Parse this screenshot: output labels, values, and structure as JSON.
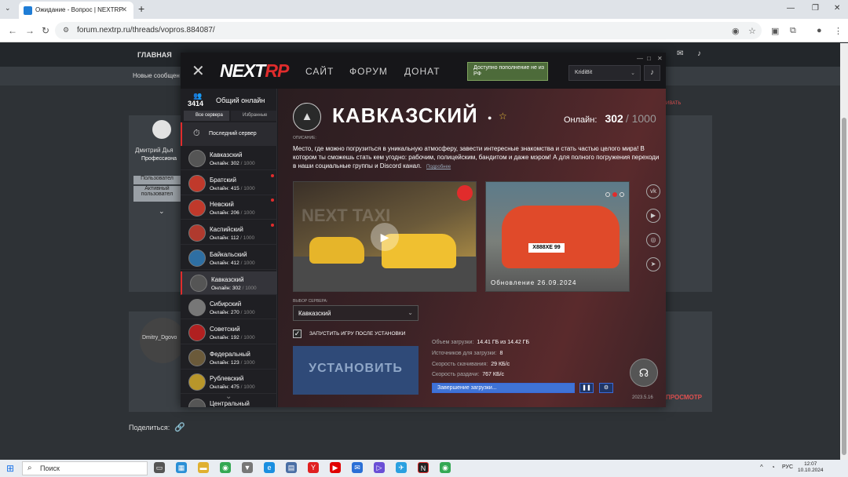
{
  "browser": {
    "tab_title": "Ожидание - Вопрос | NEXTRP",
    "url": "forum.nextrp.ru/threads/vopros.884087/"
  },
  "forum": {
    "nav_home": "ГЛАВНАЯ",
    "new_messages": "Новые сообщен",
    "user_name": "Дмитрий Дья",
    "user_role": "Профессиона",
    "btn_user": "Пользовател",
    "btn_active": "Активный пользовател",
    "reply_user": "Dmitry_Dgovo",
    "action_red": "ИВАТЬ",
    "preview": "ПРОСМОТР",
    "share_label": "Поделиться:"
  },
  "launcher": {
    "nav": [
      "САЙТ",
      "ФОРУМ",
      "ДОНАТ"
    ],
    "promo": "Доступно пополнение не из РФ",
    "username": "KridiBit",
    "online_total": "3414",
    "online_label": "Общий онлайн",
    "tab_all": "Все сервера",
    "tab_fav": "Избранные",
    "last_server": "Последний сервер",
    "online_prefix": "Онлайн:",
    "servers": [
      {
        "name": "Кавказский",
        "online": "302",
        "max": "1000",
        "icon": "mountain-icon",
        "color": "#555",
        "dot": false
      },
      {
        "name": "Братский",
        "online": "415",
        "max": "1000",
        "icon": "mountain-icon",
        "color": "#c0392b",
        "dot": true
      },
      {
        "name": "Невский",
        "online": "206",
        "max": "1000",
        "icon": "ship-icon",
        "color": "#c0392b",
        "dot": true
      },
      {
        "name": "Каспийский",
        "online": "112",
        "max": "1000",
        "icon": "wave-icon",
        "color": "#b03a2e",
        "dot": true
      },
      {
        "name": "Байкальский",
        "online": "412",
        "max": "1000",
        "icon": "lake-icon",
        "color": "#2e6fa3",
        "dot": false
      },
      {
        "name": "Кавказский",
        "online": "302",
        "max": "1000",
        "icon": "mountain-icon",
        "color": "#555",
        "dot": false
      },
      {
        "name": "Сибирский",
        "online": "270",
        "max": "1000",
        "icon": "bear-icon",
        "color": "#777",
        "dot": false
      },
      {
        "name": "Советский",
        "online": "192",
        "max": "1000",
        "icon": "hammer-sickle-icon",
        "color": "#b02020",
        "dot": false
      },
      {
        "name": "Федеральный",
        "online": "123",
        "max": "1000",
        "icon": "eagle-icon",
        "color": "#6b5a3a",
        "dot": false
      },
      {
        "name": "Рублевский",
        "online": "475",
        "max": "1000",
        "icon": "ruble-icon",
        "color": "#b8962a",
        "dot": false
      },
      {
        "name": "Центральный",
        "online": "",
        "max": "",
        "icon": "star-icon",
        "color": "#555",
        "dot": false
      }
    ],
    "server": {
      "title": "КАВКАЗСКИЙ",
      "online_label": "Онлайн:",
      "online": "302",
      "max": "/ 1000",
      "desc_caption": "ОПИСАНИЕ:",
      "description": "Место, где можно погрузиться в уникальную атмосферу, завести интересные знакомства и стать частью целого мира! В котором ты сможешь стать кем угодно: рабочим, полицейским, бандитом и даже мэром! А для полного погружения переходи в наши социальные группы и Discord канал.",
      "desc_more": "Подробнее",
      "media_watermark": "NEXT TAXI",
      "plate": "Х888ХЕ 99",
      "update_caption": "Обновление 26.09.2024"
    },
    "select_caption": "ВЫБОР СЕРВЕРА:",
    "select_value": "Кавказский",
    "checkbox_label": "ЗАПУСТИТЬ ИГРУ ПОСЛЕ УСТАНОВКИ",
    "install": "УСТАНОВИТЬ",
    "stats": [
      {
        "label": "Объем загрузки:",
        "value": "14.41 ГБ из 14.42 ГБ"
      },
      {
        "label": "Источников для загрузки:",
        "value": "8"
      },
      {
        "label": "Скорость скачивания:",
        "value": "29 КБ/с"
      },
      {
        "label": "Скорость раздачи:",
        "value": "767 КБ/с"
      }
    ],
    "progress_label": "Завершение загрузки...",
    "progress_fraction": 0.999,
    "version": "2023.5.16"
  },
  "taskbar": {
    "search": "Поиск",
    "lang": "РУС",
    "time": "12:07",
    "date": "10.10.2024"
  }
}
